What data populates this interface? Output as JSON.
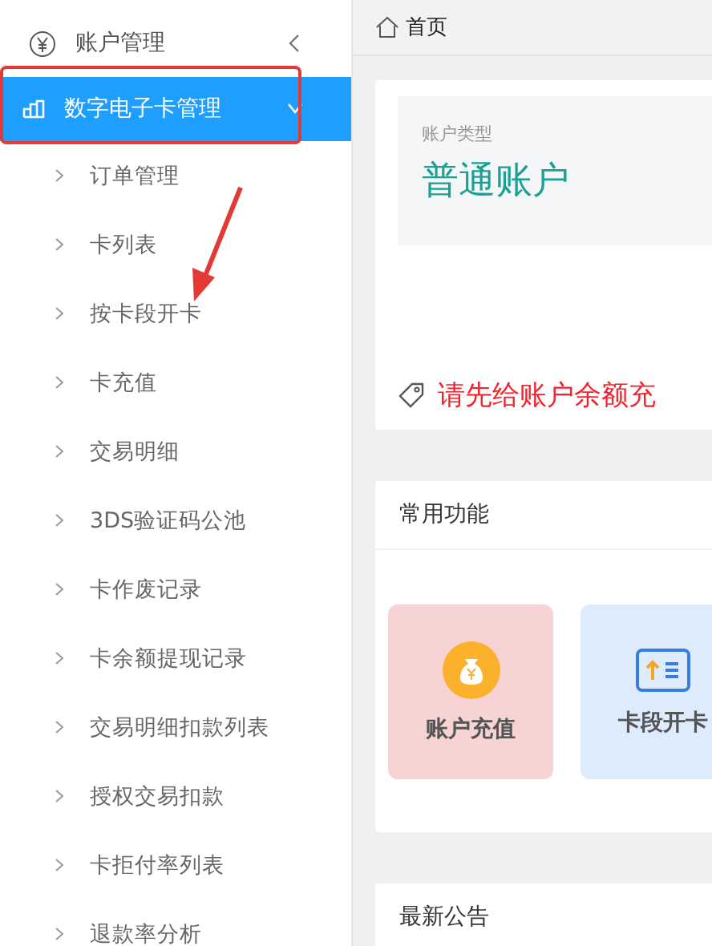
{
  "sidebar": {
    "items": [
      {
        "label": "账户管理",
        "kind": "finance",
        "expanded": false,
        "selected": false
      },
      {
        "label": "数字电子卡管理",
        "kind": "cards",
        "expanded": true,
        "selected": true,
        "children": [
          {
            "label": "订单管理",
            "selected": false
          },
          {
            "label": "卡列表",
            "selected": false
          },
          {
            "label": "按卡段开卡",
            "selected": false
          },
          {
            "label": "卡充值",
            "selected": false
          },
          {
            "label": "交易明细",
            "selected": false
          },
          {
            "label": "3DS验证码公池",
            "selected": false
          },
          {
            "label": "卡作废记录",
            "selected": false
          },
          {
            "label": "卡余额提现记录",
            "selected": false
          },
          {
            "label": "交易明细扣款列表",
            "selected": false
          },
          {
            "label": "授权交易扣款",
            "selected": false
          },
          {
            "label": "卡拒付率列表",
            "selected": false
          },
          {
            "label": "退款率分析",
            "selected": false
          }
        ]
      }
    ]
  },
  "breadcrumb": {
    "label": "首页"
  },
  "account": {
    "label": "账户类型",
    "value": "普通账户",
    "notice": "请先给账户余额充"
  },
  "shortcuts": {
    "title": "常用功能",
    "items": [
      {
        "label": "账户充值",
        "kind": "recharge",
        "color": "#f7d3d3"
      },
      {
        "label": "卡段开卡",
        "kind": "open-card",
        "color": "#deebfd"
      }
    ]
  },
  "announcements": {
    "title": "最新公告"
  }
}
